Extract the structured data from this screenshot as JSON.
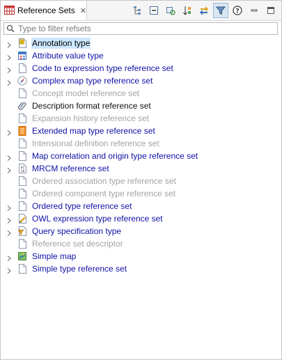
{
  "tab": {
    "title": "Reference Sets",
    "close": "✕"
  },
  "toolbar": {
    "buttons": [
      {
        "icon": "hierarchy-icon"
      },
      {
        "icon": "collapse-all-icon"
      },
      {
        "icon": "link-with-editor-icon"
      },
      {
        "icon": "sort-icon"
      },
      {
        "icon": "sync-icon"
      },
      {
        "icon": "filter-icon",
        "selected": true
      },
      {
        "icon": "help-icon"
      },
      {
        "icon": "minimize-icon"
      },
      {
        "icon": "maximize-icon"
      }
    ]
  },
  "filter": {
    "placeholder": "Type to filter refsets",
    "value": ""
  },
  "tree": {
    "items": [
      {
        "label": "Annotation type",
        "style": "sel",
        "expandable": true,
        "icon": "annotation-icon"
      },
      {
        "label": "Attribute value type",
        "style": "blue",
        "expandable": true,
        "icon": "attribute-value-icon"
      },
      {
        "label": "Code to expression type reference set",
        "style": "blue",
        "expandable": true,
        "icon": "page-icon"
      },
      {
        "label": "Complex map type reference set",
        "style": "blue",
        "expandable": true,
        "icon": "compass-icon"
      },
      {
        "label": "Concept model reference set",
        "style": "grey",
        "expandable": false,
        "icon": "page-icon"
      },
      {
        "label": "Description format reference set",
        "style": "black",
        "expandable": false,
        "icon": "paperclip-icon"
      },
      {
        "label": "Expansion history reference set",
        "style": "grey",
        "expandable": false,
        "icon": "page-icon"
      },
      {
        "label": "Extended map type reference set",
        "style": "blue",
        "expandable": true,
        "icon": "extended-map-icon"
      },
      {
        "label": "Intensional definition reference set",
        "style": "grey",
        "expandable": false,
        "icon": "page-icon"
      },
      {
        "label": "Map correlation and origin type reference set",
        "style": "blue",
        "expandable": true,
        "icon": "page-icon"
      },
      {
        "label": "MRCM reference set",
        "style": "blue",
        "expandable": true,
        "icon": "mrcm-icon"
      },
      {
        "label": "Ordered association type reference set",
        "style": "grey",
        "expandable": false,
        "icon": "page-icon"
      },
      {
        "label": "Ordered component type reference set",
        "style": "grey",
        "expandable": false,
        "icon": "page-icon"
      },
      {
        "label": "Ordered type reference set",
        "style": "blue",
        "expandable": true,
        "icon": "page-icon"
      },
      {
        "label": "OWL expression type reference set",
        "style": "blue",
        "expandable": true,
        "icon": "owl-pencil-icon"
      },
      {
        "label": "Query specification type",
        "style": "blue",
        "expandable": true,
        "icon": "query-icon"
      },
      {
        "label": "Reference set descriptor",
        "style": "grey",
        "expandable": false,
        "icon": "page-icon"
      },
      {
        "label": "Simple map",
        "style": "blue",
        "expandable": true,
        "icon": "simple-map-icon"
      },
      {
        "label": "Simple type reference set",
        "style": "blue",
        "expandable": true,
        "icon": "page-icon"
      }
    ]
  },
  "colors": {
    "link": "#1010a8",
    "disabled": "#a3a3a3",
    "selection": "#cde8ff"
  }
}
